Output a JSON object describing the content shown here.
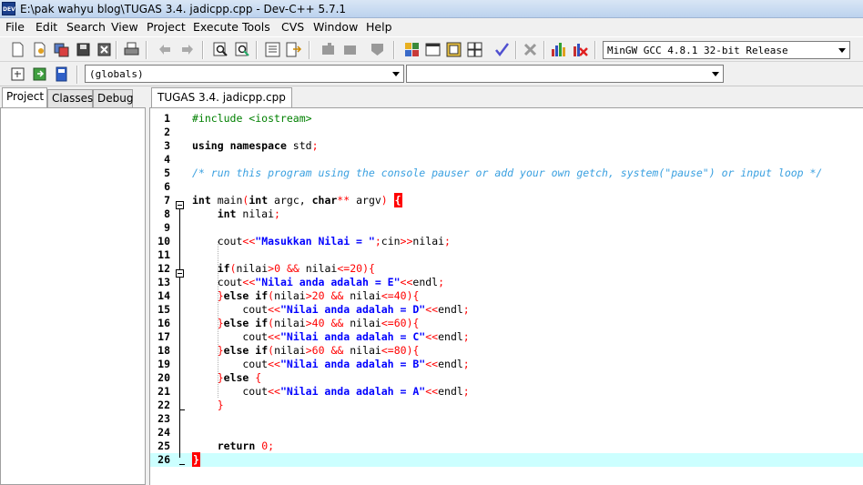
{
  "window": {
    "title": "E:\\pak wahyu blog\\TUGAS 3.4. jadicpp.cpp - Dev-C++ 5.7.1",
    "logo": "DEV"
  },
  "menu": [
    "File",
    "Edit",
    "Search",
    "View",
    "Project",
    "Execute",
    "Tools",
    "CVS",
    "Window",
    "Help"
  ],
  "toolbar": {
    "compiler": "MinGW GCC 4.8.1 32-bit Release",
    "scope": "(globals)",
    "member": ""
  },
  "left_tabs": [
    "Project",
    "Classes",
    "Debug"
  ],
  "editor_tab": "TUGAS 3.4. jadicpp.cpp",
  "code_lines": [
    {
      "n": "1",
      "text": "#include <iostream>"
    },
    {
      "n": "2",
      "text": ""
    },
    {
      "n": "3",
      "text": "using namespace std;"
    },
    {
      "n": "4",
      "text": ""
    },
    {
      "n": "5",
      "text": "/* run this program using the console pauser or add your own getch, system(\"pause\") or input loop */"
    },
    {
      "n": "6",
      "text": ""
    },
    {
      "n": "7",
      "text": "int main(int argc, char** argv) {"
    },
    {
      "n": "8",
      "text": "    int nilai;"
    },
    {
      "n": "9",
      "text": ""
    },
    {
      "n": "10",
      "text": "    cout<<\"Masukkan Nilai = \";cin>>nilai;"
    },
    {
      "n": "11",
      "text": ""
    },
    {
      "n": "12",
      "text": "    if(nilai>0 && nilai<=20){"
    },
    {
      "n": "13",
      "text": "    cout<<\"Nilai anda adalah = E\"<<endl;"
    },
    {
      "n": "14",
      "text": "    }else if(nilai>20 && nilai<=40){"
    },
    {
      "n": "15",
      "text": "        cout<<\"Nilai anda adalah = D\"<<endl;"
    },
    {
      "n": "16",
      "text": "    }else if(nilai>40 && nilai<=60){"
    },
    {
      "n": "17",
      "text": "        cout<<\"Nilai anda adalah = C\"<<endl;"
    },
    {
      "n": "18",
      "text": "    }else if(nilai>60 && nilai<=80){"
    },
    {
      "n": "19",
      "text": "        cout<<\"Nilai anda adalah = B\"<<endl;"
    },
    {
      "n": "20",
      "text": "    }else {"
    },
    {
      "n": "21",
      "text": "        cout<<\"Nilai anda adalah = A\"<<endl;"
    },
    {
      "n": "22",
      "text": "    }"
    },
    {
      "n": "23",
      "text": ""
    },
    {
      "n": "24",
      "text": ""
    },
    {
      "n": "25",
      "text": "    return 0;"
    },
    {
      "n": "26",
      "text": "}"
    }
  ],
  "current_line": "26",
  "colors": {
    "current_line": "#ccffff",
    "brace_highlight": "#ff0000",
    "comment": "#3aa0e0",
    "string": "#0000ff",
    "number": "#ff0000",
    "preprocessor": "#008000"
  }
}
